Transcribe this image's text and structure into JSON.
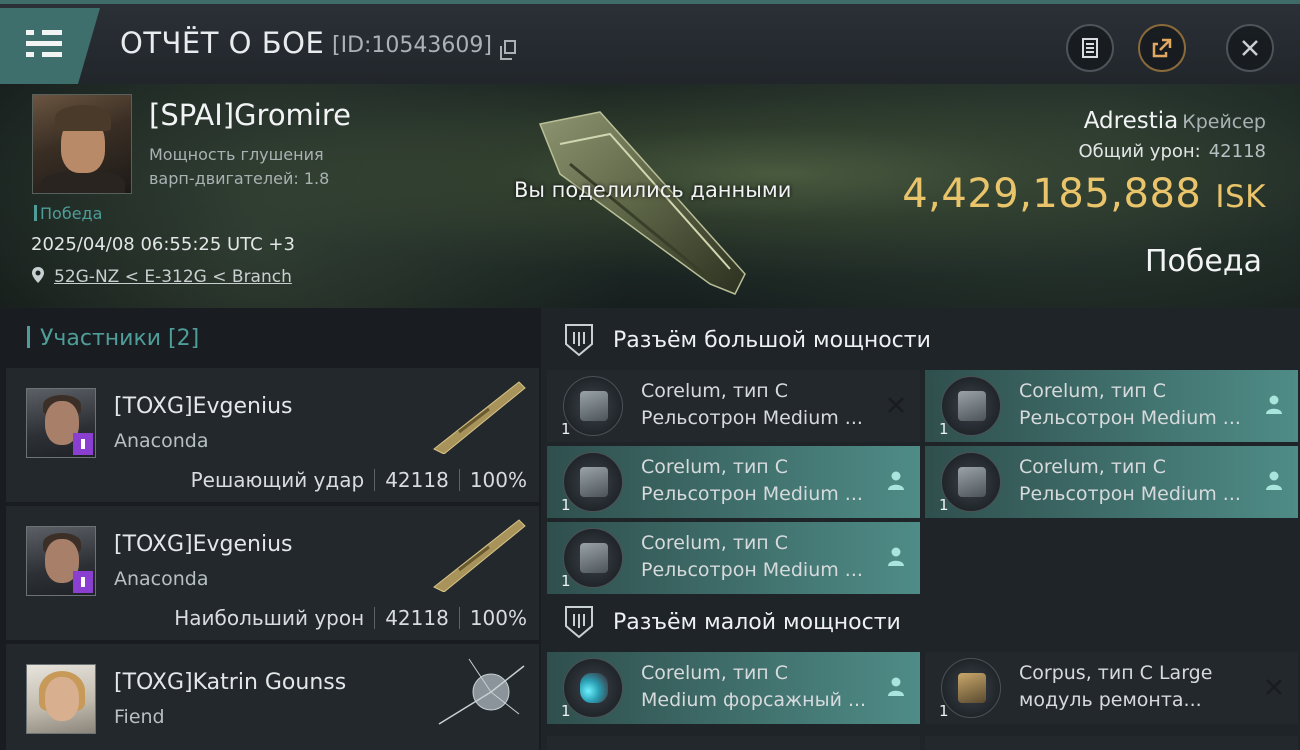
{
  "header": {
    "title": "ОТЧЁТ О БОЕ",
    "id_label": "[ID:10543609]"
  },
  "hero": {
    "pilot_name": "[SPAI]Gromire",
    "pilot_stat_line1": "Мощность глушения",
    "pilot_stat_line2": "варп-двигателей: 1.8",
    "victory_tag": "Победа",
    "datetime": "2025/04/08 06:55:25 UTC +3",
    "location": "52G-NZ < E-312G < Branch",
    "share_notice": "Вы поделились данными",
    "ship_name": "Adrestia",
    "ship_class": "Крейсер",
    "total_damage_label": "Общий урон:",
    "total_damage_value": "42118",
    "isk_value": "4,429,185,888",
    "isk_unit": "ISK",
    "result": "Победа"
  },
  "participants": {
    "header": "Участники [2]",
    "rows": [
      {
        "name": "[TOXG]Evgenius",
        "ship": "Anaconda",
        "role": "Решающий удар",
        "damage": "42118",
        "percent": "100%"
      },
      {
        "name": "[TOXG]Evgenius",
        "ship": "Anaconda",
        "role": "Наибольший урон",
        "damage": "42118",
        "percent": "100%"
      },
      {
        "name": "[TOXG]Katrin Gounss",
        "ship": "Fiend"
      }
    ]
  },
  "high_slots": {
    "title": "Разъём большой мощности",
    "modules": [
      {
        "line1": "Corelum, тип C",
        "line2": "Рельсотрон Medium ...",
        "qty": "1",
        "mark": "x-icon"
      },
      {
        "line1": "Corelum, тип C",
        "line2": "Рельсотрон Medium ...",
        "qty": "1",
        "mark": "person-icon"
      },
      {
        "line1": "Corelum, тип C",
        "line2": "Рельсотрон Medium ...",
        "qty": "1",
        "mark": "person-icon"
      },
      {
        "line1": "Corelum, тип C",
        "line2": "Рельсотрон Medium ...",
        "qty": "1",
        "mark": "person-icon"
      },
      {
        "line1": "Corelum, тип C",
        "line2": "Рельсотрон Medium ...",
        "qty": "1",
        "mark": "person-icon"
      }
    ]
  },
  "low_slots": {
    "title": "Разъём малой мощности",
    "modules": [
      {
        "line1": "Corelum, тип C",
        "line2": "Medium форсажный ...",
        "qty": "1",
        "mark": "person-icon"
      },
      {
        "line1": "Corpus, тип C Large",
        "line2": "модуль ремонта...",
        "qty": "1",
        "mark": "x-icon"
      }
    ]
  },
  "colors": {
    "accent_teal": "#4f9d98",
    "isk_gold": "#e9c46a",
    "highlight_slot": "#4f8c87"
  }
}
